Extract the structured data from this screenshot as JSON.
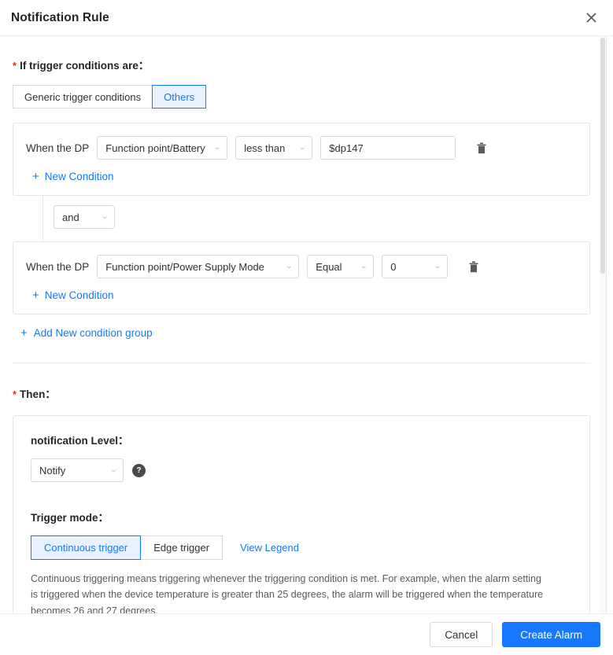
{
  "dialog": {
    "title": "Notification Rule",
    "close_icon": "close-icon"
  },
  "trigger_section": {
    "label": "If trigger conditions are：",
    "required_marker": "*",
    "tabs": [
      {
        "label": "Generic trigger conditions",
        "active": false
      },
      {
        "label": "Others",
        "active": true
      }
    ],
    "condition_groups": [
      {
        "conditions": [
          {
            "prefix": "When the DP",
            "datapoint": "Function point/Battery",
            "operator": "less than",
            "value": "$dp147",
            "value_kind": "text",
            "delete_icon": "trash-icon"
          }
        ],
        "new_condition_label": "New Condition"
      },
      {
        "conditions": [
          {
            "prefix": "When the DP",
            "datapoint": "Function point/Power Supply Mode",
            "operator": "Equal",
            "value": "0",
            "value_kind": "select",
            "delete_icon": "trash-icon"
          }
        ],
        "new_condition_label": "New Condition"
      }
    ],
    "group_joiner": "and",
    "add_group_label": "Add New condition group",
    "plus_glyph": "+"
  },
  "then_section": {
    "label": "Then：",
    "required_marker": "*",
    "notification_level": {
      "label": "notification Level：",
      "value": "Notify",
      "help_icon": "question-mark-icon",
      "help_glyph": "?"
    },
    "trigger_mode": {
      "label": "Trigger mode：",
      "options": [
        {
          "label": "Continuous trigger",
          "active": true
        },
        {
          "label": "Edge trigger",
          "active": false
        }
      ],
      "legend_link": "View Legend",
      "description": "Continuous triggering means triggering whenever the triggering condition is met. For example, when the alarm setting is triggered when the device temperature is greater than 25 degrees, the alarm will be triggered when the temperature becomes 26 and 27 degrees."
    }
  },
  "footer": {
    "cancel_label": "Cancel",
    "submit_label": "Create Alarm"
  },
  "colors": {
    "accent": "#1677ff",
    "accent_soft": "#e8f3ff",
    "required": "#f5222d",
    "border": "#d9d9d9"
  }
}
